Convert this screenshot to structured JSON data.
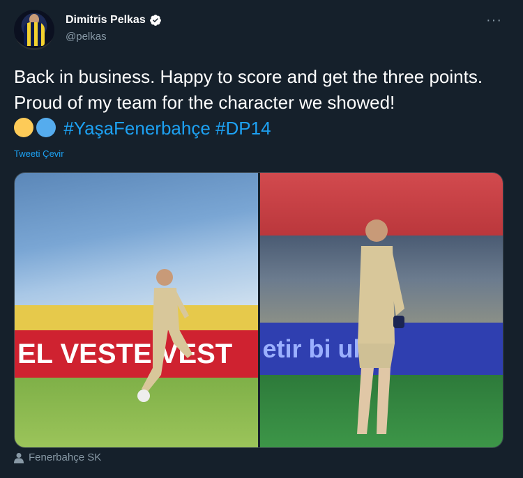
{
  "author": {
    "name": "Dimitris Pelkas",
    "handle": "@pelkas",
    "verified": true,
    "avatar_icon": "avatar-photo"
  },
  "menu": {
    "more_label": "···"
  },
  "tweet": {
    "text_line": "Back in business. Happy to score and get the three points. Proud of my team for the character we showed!",
    "emojis": [
      {
        "name": "yellow-circle-emoji",
        "color": "#fdcb58"
      },
      {
        "name": "blue-circle-emoji",
        "color": "#55acee"
      }
    ],
    "hashtags": [
      "#YaşaFenerbahçe",
      "#DP14"
    ],
    "translate_label": "Tweeti Çevir"
  },
  "media": {
    "photos": [
      {
        "ad_text": "EL VESTE VEST"
      },
      {
        "ad_text": "etir bi   ulut"
      }
    ]
  },
  "location": {
    "icon": "person-icon",
    "label": "Fenerbahçe SK"
  },
  "colors": {
    "background": "#15202b",
    "link": "#1da1f2",
    "secondary_text": "#8899a6"
  }
}
